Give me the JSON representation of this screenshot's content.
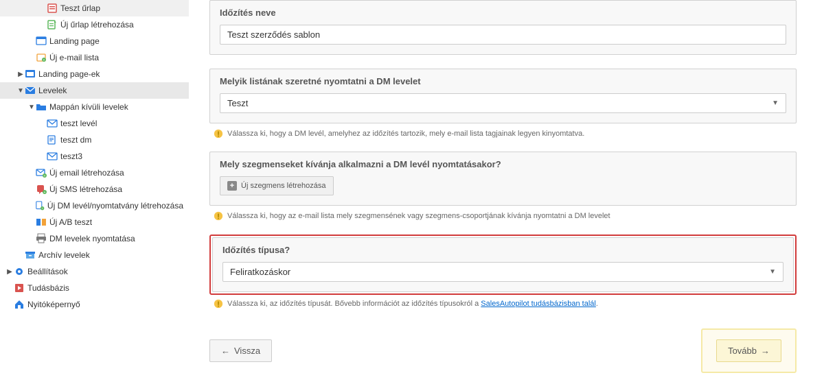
{
  "sidebar": {
    "items": [
      {
        "label": "Teszt űrlap",
        "level": 3,
        "icon": "form-icon",
        "caret": ""
      },
      {
        "label": "Új űrlap létrehozása",
        "level": 3,
        "icon": "new-form-icon",
        "caret": ""
      },
      {
        "label": "Landing page",
        "level": 2,
        "icon": "landing-icon",
        "caret": ""
      },
      {
        "label": "Új e-mail lista",
        "level": 2,
        "icon": "new-list-icon",
        "caret": ""
      },
      {
        "label": "Landing page-ek",
        "level": 1,
        "icon": "landing-pages-icon",
        "caret": "right"
      },
      {
        "label": "Levelek",
        "level": 1,
        "icon": "letters-icon",
        "caret": "down",
        "selected": true
      },
      {
        "label": "Mappán kívüli levelek",
        "level": 2,
        "icon": "folder-icon",
        "caret": "down"
      },
      {
        "label": "teszt levél",
        "level": 3,
        "icon": "envelope-icon",
        "caret": ""
      },
      {
        "label": "teszt dm",
        "level": 3,
        "icon": "dm-icon",
        "caret": ""
      },
      {
        "label": "teszt3",
        "level": 3,
        "icon": "envelope-icon",
        "caret": ""
      },
      {
        "label": "Új email létrehozása",
        "level": 2,
        "icon": "new-email-icon",
        "caret": ""
      },
      {
        "label": "Új SMS létrehozása",
        "level": 2,
        "icon": "new-sms-icon",
        "caret": ""
      },
      {
        "label": "Új DM levél/nyomtatvány létrehozása",
        "level": 2,
        "icon": "new-dm-icon",
        "caret": ""
      },
      {
        "label": "Új A/B teszt",
        "level": 2,
        "icon": "ab-test-icon",
        "caret": ""
      },
      {
        "label": "DM levelek nyomtatása",
        "level": 2,
        "icon": "print-icon",
        "caret": ""
      },
      {
        "label": "Archív levelek",
        "level": 1,
        "icon": "archive-icon",
        "caret": ""
      },
      {
        "label": "Beállítások",
        "level": 0,
        "icon": "settings-icon",
        "caret": "right"
      },
      {
        "label": "Tudásbázis",
        "level": 0,
        "icon": "kb-icon",
        "caret": ""
      },
      {
        "label": "Nyitóképernyő",
        "level": 0,
        "icon": "home-icon",
        "caret": ""
      }
    ]
  },
  "form": {
    "name_label": "Időzítés neve",
    "name_value": "Teszt szerződés sablon",
    "list_label": "Melyik listának szeretné nyomtatni a DM levelet",
    "list_value": "Teszt",
    "list_hint": "Válassza ki, hogy a DM levél, amelyhez az időzítés tartozik, mely e-mail lista tagjainak legyen kinyomtatva.",
    "segment_label": "Mely szegmenseket kívánja alkalmazni a DM levél nyomtatásakor?",
    "segment_button": "Új szegmens létrehozása",
    "segment_hint": "Válassza ki, hogy az e-mail lista mely szegmensének vagy szegmens-csoportjának kívánja nyomtatni a DM levelet",
    "type_label": "Időzítés típusa?",
    "type_value": "Feliratkozáskor",
    "type_hint_prefix": "Válassza ki, az időzítés típusát. Bővebb információt az időzítés típusokról a ",
    "type_hint_link": "SalesAutopilot tudásbázisban talál",
    "type_hint_suffix": "."
  },
  "nav": {
    "back": "Vissza",
    "next": "Tovább"
  }
}
